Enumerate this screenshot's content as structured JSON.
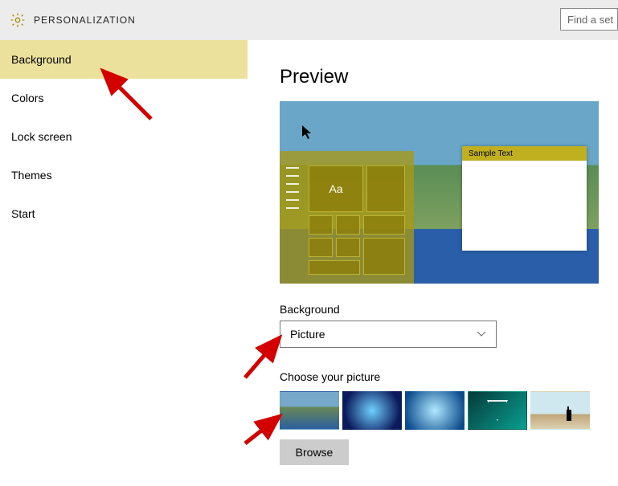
{
  "header": {
    "title": "PERSONALIZATION",
    "search_placeholder": "Find a set"
  },
  "sidebar": {
    "items": [
      {
        "label": "Background",
        "selected": true
      },
      {
        "label": "Colors",
        "selected": false
      },
      {
        "label": "Lock screen",
        "selected": false
      },
      {
        "label": "Themes",
        "selected": false
      },
      {
        "label": "Start",
        "selected": false
      }
    ]
  },
  "main": {
    "preview_title": "Preview",
    "preview_sample_text": "Sample Text",
    "preview_tile_text": "Aa",
    "background_label": "Background",
    "background_dropdown": {
      "selected": "Picture"
    },
    "choose_picture_label": "Choose your picture",
    "thumbnails": [
      {
        "name": "wallpaper-crater-coast"
      },
      {
        "name": "wallpaper-windows-dark"
      },
      {
        "name": "wallpaper-windows-light"
      },
      {
        "name": "wallpaper-triangle-teal"
      },
      {
        "name": "wallpaper-beach-person"
      }
    ],
    "browse_label": "Browse"
  },
  "colors": {
    "accent": "#b5a61e",
    "header_bg": "#ececec",
    "selected_nav_bg": "#ebe19c"
  }
}
